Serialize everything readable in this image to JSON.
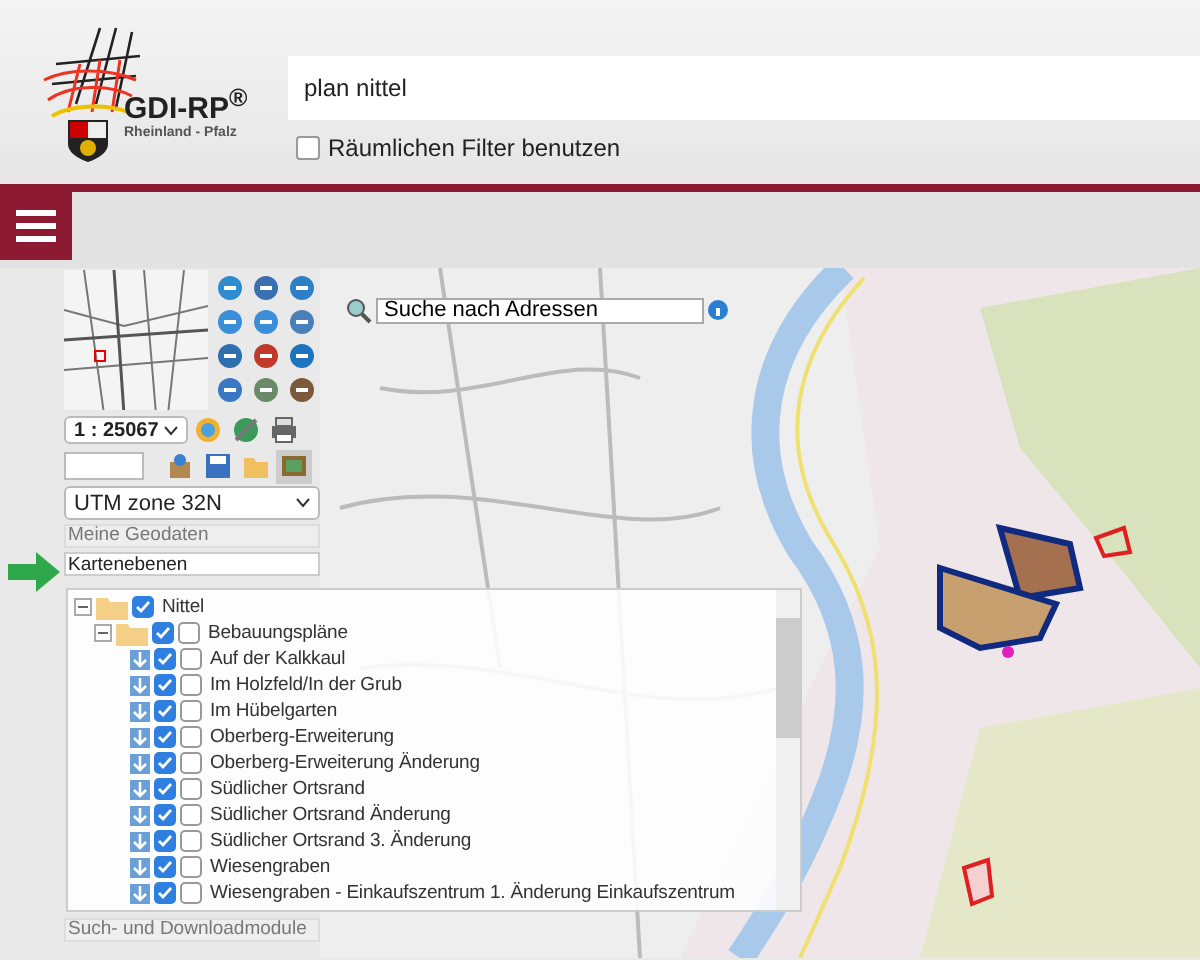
{
  "logo": {
    "title": "GDI-RP$^{®}$",
    "subtitle": "Rheinland - Pfalz"
  },
  "search": {
    "value": "plan nittel"
  },
  "spatial_filter": {
    "label": "Räumlichen Filter benutzen",
    "checked": false
  },
  "scale": {
    "value": "1 : 25067"
  },
  "projection": {
    "value": "UTM zone 32N"
  },
  "section_title": "Meine Geodaten",
  "layers_field": {
    "value": "Kartenebenen"
  },
  "tree": [
    {
      "label": "Nittel",
      "kind": "folder",
      "expanded": true,
      "checked": true,
      "children": [
        {
          "label": "Bebauungspläne",
          "kind": "folder",
          "expanded": true,
          "checked": true,
          "queryable": false,
          "children": [
            {
              "label": "Auf der Kalkkaul",
              "kind": "layer",
              "checked": true,
              "queryable": false
            },
            {
              "label": "Im Holzfeld/In der Grub",
              "kind": "layer",
              "checked": true,
              "queryable": false
            },
            {
              "label": "Im Hübelgarten",
              "kind": "layer",
              "checked": true,
              "queryable": false
            },
            {
              "label": "Oberberg-Erweiterung",
              "kind": "layer",
              "checked": true,
              "queryable": false
            },
            {
              "label": "Oberberg-Erweiterung Änderung",
              "kind": "layer",
              "checked": true,
              "queryable": false
            },
            {
              "label": "Südlicher Ortsrand",
              "kind": "layer",
              "checked": true,
              "queryable": false
            },
            {
              "label": "Südlicher Ortsrand Änderung",
              "kind": "layer",
              "checked": true,
              "queryable": false
            },
            {
              "label": "Südlicher Ortsrand 3. Änderung",
              "kind": "layer",
              "checked": true,
              "queryable": false
            },
            {
              "label": "Wiesengraben",
              "kind": "layer",
              "checked": true,
              "queryable": false
            },
            {
              "label": "Wiesengraben - Einkaufszentrum 1. Änderung Einkaufszentrum",
              "kind": "layer",
              "checked": true,
              "queryable": false
            }
          ]
        }
      ]
    }
  ],
  "modules_title": "Such- und Downloadmodule",
  "address_search": {
    "value": "Suche nach Adressen"
  }
}
